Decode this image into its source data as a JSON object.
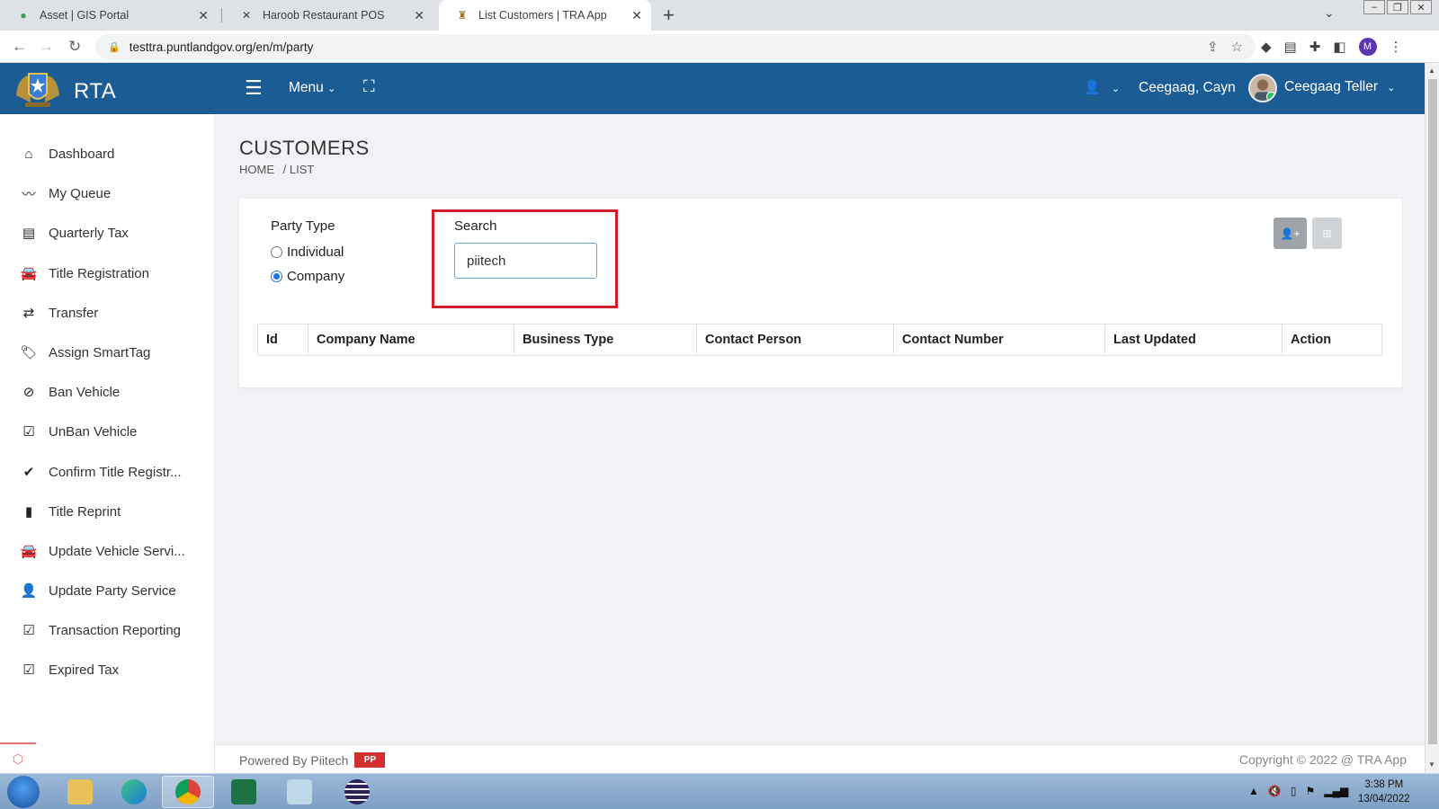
{
  "browser": {
    "tabs": [
      {
        "title": "Asset | GIS Portal",
        "active": false
      },
      {
        "title": "Haroob Restaurant POS",
        "active": false
      },
      {
        "title": "List Customers | TRA App",
        "active": true
      }
    ],
    "url": "testtra.puntlandgov.org/en/m/party",
    "profile_initial": "M"
  },
  "header": {
    "brand": "RTA",
    "menu_label": "Menu",
    "user_name": "Ceegaag, Cayn",
    "role": "Ceegaag Teller",
    "color": "#1b5c94"
  },
  "sidebar": {
    "items": [
      {
        "label": "Dashboard",
        "icon": "home-icon"
      },
      {
        "label": "My Queue",
        "icon": "trend-icon"
      },
      {
        "label": "Quarterly Tax",
        "icon": "list-icon"
      },
      {
        "label": "Title Registration",
        "icon": "car-icon"
      },
      {
        "label": "Transfer",
        "icon": "exchange-icon"
      },
      {
        "label": "Assign SmartTag",
        "icon": "tags-icon"
      },
      {
        "label": "Ban Vehicle",
        "icon": "ban-icon"
      },
      {
        "label": "UnBan Vehicle",
        "icon": "check-square-icon"
      },
      {
        "label": "Confirm Title Registr...",
        "icon": "check-icon"
      },
      {
        "label": "Title Reprint",
        "icon": "file-icon"
      },
      {
        "label": "Update Vehicle Servi...",
        "icon": "car-icon"
      },
      {
        "label": "Update Party Service",
        "icon": "user-icon"
      },
      {
        "label": "Transaction Reporting",
        "icon": "check-square-icon"
      },
      {
        "label": "Expired Tax",
        "icon": "check-square-icon"
      }
    ]
  },
  "page": {
    "title": "CUSTOMERS",
    "breadcrumb": [
      "HOME",
      "/ LIST"
    ]
  },
  "filters": {
    "party_type_label": "Party Type",
    "options": [
      {
        "label": "Individual",
        "checked": false
      },
      {
        "label": "Company",
        "checked": true
      }
    ],
    "search_label": "Search",
    "search_value": "piitech"
  },
  "table": {
    "columns": [
      "Id",
      "Company Name",
      "Business Type",
      "Contact Person",
      "Contact Number",
      "Last Updated",
      "Action"
    ]
  },
  "footer": {
    "powered_by": "Powered By Piitech",
    "logo_text": "PP",
    "copyright": "Copyright © 2022 @ TRA App"
  },
  "taskbar": {
    "time": "3:38 PM",
    "date": "13/04/2022"
  }
}
